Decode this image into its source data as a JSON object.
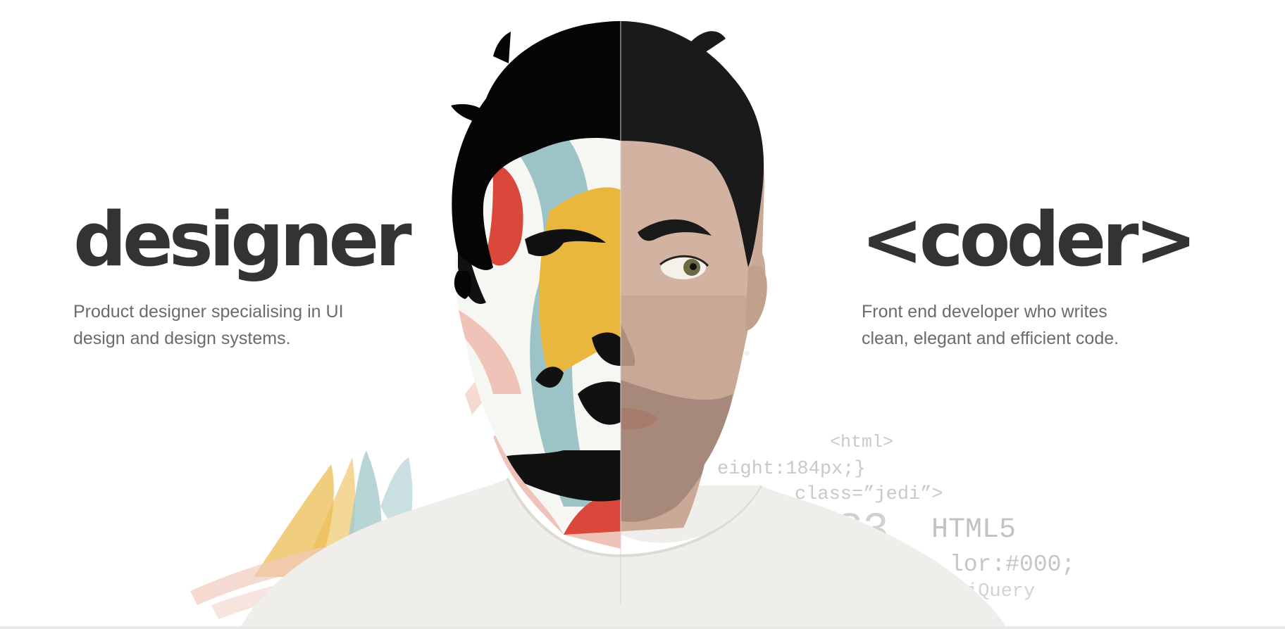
{
  "left": {
    "title": "designer",
    "description_lines": [
      "Product designer specialising in UI",
      "design and design systems."
    ]
  },
  "right": {
    "title": "<coder>",
    "description_lines": [
      "Front end developer who writes",
      "clean, elegant and efficient code."
    ]
  },
  "code_snippets": [
    "<html>",
    "eight:184px;}",
    "class=”jedi”>",
    "SS3",
    "HTML5",
    "lor:#000;",
    "iQuery"
  ],
  "colors": {
    "heading": "#333333",
    "body_text": "#6b6b6b",
    "code_text": "#c9c9c9",
    "paint_teal": "#9cc4c6",
    "paint_yellow": "#e9b63e",
    "paint_red": "#d9483a",
    "paint_pink": "#efc3b7",
    "shirt": "#efeeea",
    "skin": "#c9a896",
    "hair": "#1a1a1a"
  }
}
